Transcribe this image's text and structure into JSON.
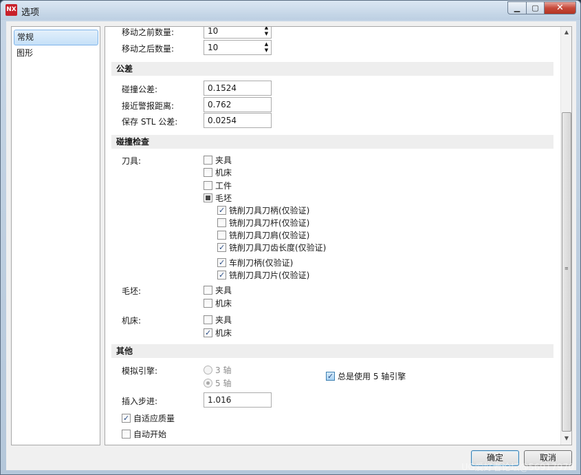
{
  "window": {
    "title": "选项",
    "app_icon_text": "NX"
  },
  "sidebar": {
    "items": [
      {
        "label": "常规",
        "selected": true
      },
      {
        "label": "图形",
        "selected": false
      }
    ]
  },
  "movement": {
    "before_label": "移动之前数量:",
    "before_value": "10",
    "after_label": "移动之后数量:",
    "after_value": "10"
  },
  "tolerance": {
    "header": "公差",
    "collision_label": "碰撞公差:",
    "collision_value": "0.1524",
    "near_miss_label": "接近警报距离:",
    "near_miss_value": "0.762",
    "stl_label": "保存 STL 公差:",
    "stl_value": "0.0254"
  },
  "collision_check": {
    "header": "碰撞检查",
    "tool_label": "刀具:",
    "tool_items": [
      {
        "label": "夹具",
        "state": "unchecked"
      },
      {
        "label": "机床",
        "state": "unchecked"
      },
      {
        "label": "工件",
        "state": "unchecked"
      },
      {
        "label": "毛坯",
        "state": "partial"
      }
    ],
    "tool_sub_items": [
      {
        "label": "铣削刀具刀柄(仅验证)",
        "state": "checked"
      },
      {
        "label": "铣削刀具刀杆(仅验证)",
        "state": "unchecked"
      },
      {
        "label": "铣削刀具刀肩(仅验证)",
        "state": "unchecked"
      },
      {
        "label": "铣削刀具刀齿长度(仅验证)",
        "state": "checked"
      },
      {
        "label": "车削刀柄(仅验证)",
        "state": "checked"
      },
      {
        "label": "铣削刀具刀片(仅验证)",
        "state": "checked"
      }
    ],
    "stock_label": "毛坯:",
    "stock_items": [
      {
        "label": "夹具",
        "state": "unchecked"
      },
      {
        "label": "机床",
        "state": "unchecked"
      }
    ],
    "machine_label": "机床:",
    "machine_items": [
      {
        "label": "夹具",
        "state": "unchecked"
      },
      {
        "label": "机床",
        "state": "checked"
      }
    ]
  },
  "other": {
    "header": "其他",
    "engine_label": "模拟引擎:",
    "axis3_label": "3 轴",
    "axis5_label": "5 轴",
    "always5_label": "总是使用 5 轴引擎",
    "step_label": "插入步进:",
    "step_value": "1.016",
    "adaptive_label": "自适应质量",
    "autostart_label": "自动开始"
  },
  "buttons": {
    "ok_label": "确定",
    "cancel_label": "取消"
  },
  "watermark": "UG爱好者论坛@56917970"
}
